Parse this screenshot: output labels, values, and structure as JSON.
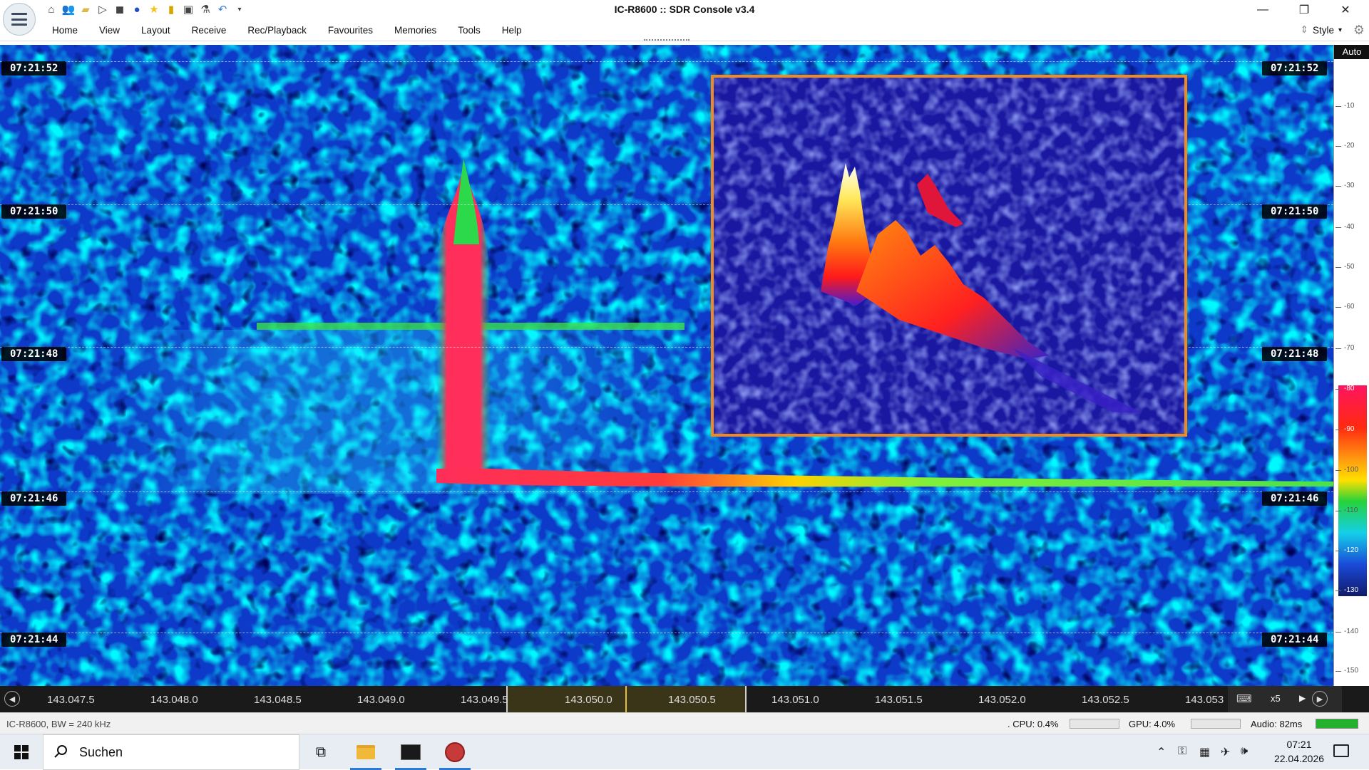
{
  "window": {
    "title": "IC-R8600 :: SDR Console v3.4",
    "minimize_icon": "minimize-icon",
    "restore_icon": "restore-icon",
    "close_icon": "close-icon"
  },
  "quick_access": [
    "home-icon",
    "users-icon",
    "folder-icon",
    "play-icon",
    "stop-icon",
    "record-icon",
    "favourite-star-icon",
    "lock-icon",
    "camera-icon",
    "flask-icon",
    "undo-icon",
    "dropdown-icon"
  ],
  "menu": {
    "items": [
      "Home",
      "View",
      "Layout",
      "Receive",
      "Rec/Playback",
      "Favourites",
      "Memories",
      "Tools",
      "Help"
    ],
    "style_label": "Style"
  },
  "waterfall": {
    "time_labels": [
      "07:21:52",
      "07:21:50",
      "07:21:48",
      "07:21:46",
      "07:21:44"
    ],
    "colors": {
      "inset_border": "#f08a1e",
      "background": "#0e2bb8"
    }
  },
  "scale": {
    "auto_label": "Auto",
    "ticks": [
      "-10",
      "-20",
      "-30",
      "-40",
      "-50",
      "-60",
      "-70",
      "-80",
      "-90",
      "-100",
      "-110",
      "-120",
      "-130",
      "-140",
      "-150"
    ]
  },
  "ruler": {
    "labels": [
      "143.047.5",
      "143.048.0",
      "143.048.5",
      "143.049.0",
      "143.049.5",
      "143.050.0",
      "143.050.5",
      "143.051.0",
      "143.051.5",
      "143.052.0",
      "143.052.5",
      "143.053"
    ],
    "zoom": "x5"
  },
  "status": {
    "device": "IC-R8600, BW = 240 kHz",
    "cpu": ". CPU: 0.4%",
    "gpu": "GPU: 4.0%",
    "audio": "Audio: 82ms"
  },
  "taskbar": {
    "search_placeholder": "Suchen",
    "time": "07:21",
    "date": "22.04.2026"
  }
}
